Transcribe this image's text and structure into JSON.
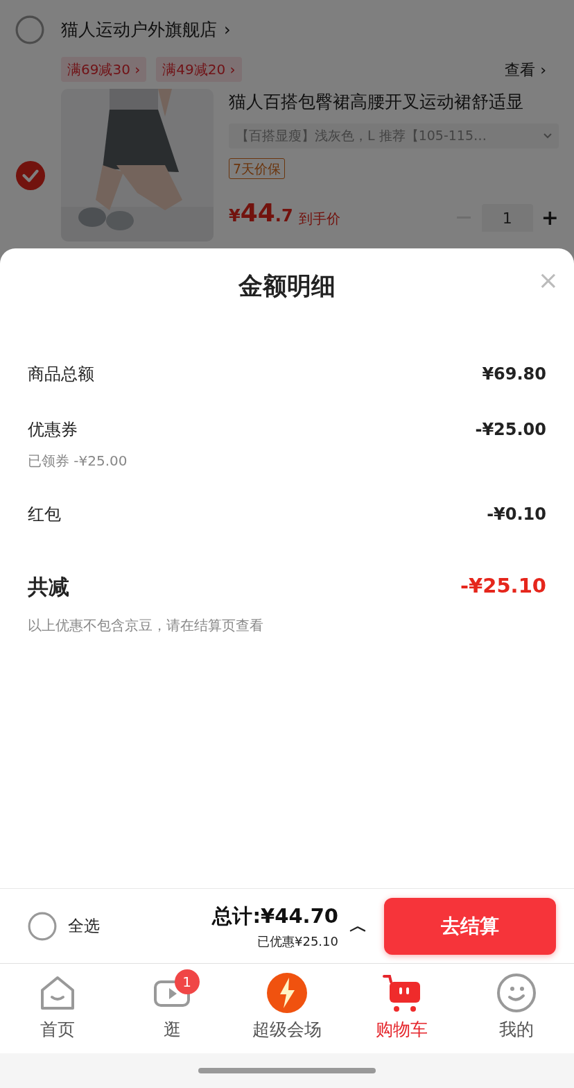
{
  "store": {
    "name": "猫人运动户外旗舰店",
    "arrow": "›",
    "checked": false
  },
  "promos": [
    "满69减30 ›",
    "满49减20 ›"
  ],
  "view_link": "查看 ›",
  "product": {
    "checked": true,
    "title": "猫人百搭包臀裙高腰开叉运动裙舒适显",
    "spec": "【百搭显瘦】浅灰色，L 推荐【105-115…",
    "tag": "7天价保",
    "currency": "¥",
    "price_int": "44",
    "price_dec": ".7",
    "price_note": "到手价",
    "quantity": "1",
    "plus": "+"
  },
  "sheet": {
    "title": "金额明细",
    "close": "×",
    "rows": [
      {
        "label": "商品总额",
        "value": "¥69.80"
      },
      {
        "label": "优惠券",
        "value": "-¥25.00",
        "sub": "已领券 -¥25.00"
      },
      {
        "label": "红包",
        "value": "-¥0.10"
      }
    ],
    "total": {
      "label": "共减",
      "value": "-¥25.10"
    },
    "note": "以上优惠不包含京豆，请在结算页查看"
  },
  "footer": {
    "select_all": {
      "label": "全选",
      "checked": false
    },
    "total": "总计:¥44.70",
    "saved": "已优惠¥25.10",
    "expand": "︿",
    "checkout": "去结算"
  },
  "tabs": [
    {
      "label": "首页",
      "kind": "home",
      "selected": false
    },
    {
      "label": "逛",
      "kind": "video",
      "selected": false,
      "badge": "1"
    },
    {
      "label": "超级会场",
      "kind": "bolt",
      "selected": false
    },
    {
      "label": "购物车",
      "kind": "cart",
      "selected": true
    },
    {
      "label": "我的",
      "kind": "smile",
      "selected": false
    }
  ]
}
